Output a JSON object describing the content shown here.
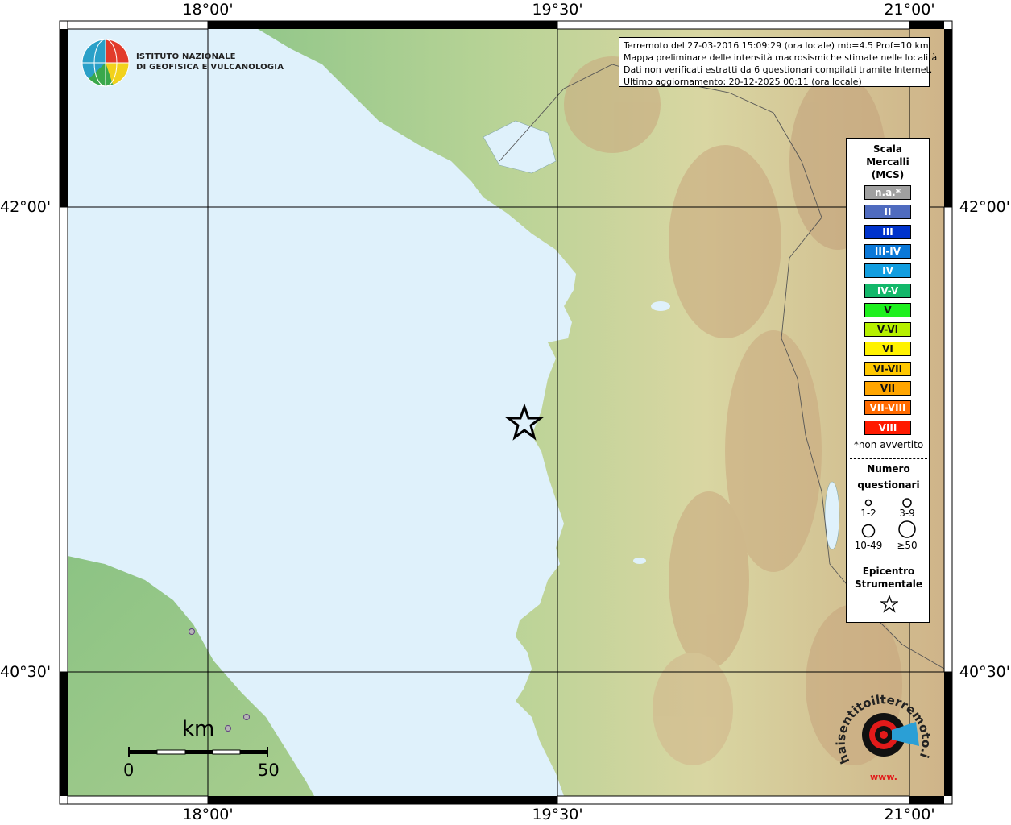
{
  "axes": {
    "lon_ticks": [
      "18°00'",
      "19°30'",
      "21°00'"
    ],
    "lat_ticks": [
      "42°00'",
      "40°30'"
    ]
  },
  "logo": {
    "line1": "ISTITUTO NAZIONALE",
    "line2": "DI GEOFISICA E VULCANOLOGIA"
  },
  "info": {
    "line1": "Terremoto del 27-03-2016 15:09:29 (ora locale) mb=4.5 Prof=10 km",
    "line2": "Mappa preliminare delle intensità macrosismiche stimate nelle località",
    "line3": "Dati non verificati estratti da 6 questionari compilati tramite Internet.",
    "line4": "Ultimo aggiornamento: 20-12-2025 00:11 (ora locale)"
  },
  "legend": {
    "title_line1": "Scala",
    "title_line2": "Mercalli",
    "title_line3": "(MCS)",
    "scale": [
      {
        "label": "n.a.*",
        "color": "#a0a0a0"
      },
      {
        "label": "II",
        "color": "#4f6bbf"
      },
      {
        "label": "III",
        "color": "#0033cc"
      },
      {
        "label": "III-IV",
        "color": "#0a78d8"
      },
      {
        "label": "IV",
        "color": "#129ee0"
      },
      {
        "label": "IV-V",
        "color": "#13b86a"
      },
      {
        "label": "V",
        "color": "#1ef01e"
      },
      {
        "label": "V-VI",
        "color": "#b6f000"
      },
      {
        "label": "VI",
        "color": "#fff200"
      },
      {
        "label": "VI-VII",
        "color": "#ffc800"
      },
      {
        "label": "VII",
        "color": "#ffa500"
      },
      {
        "label": "VII-VIII",
        "color": "#ff6a00"
      },
      {
        "label": "VIII",
        "color": "#ff1a00"
      }
    ],
    "not_felt_note": "*non avvertito",
    "questionnaire_title_line1": "Numero",
    "questionnaire_title_line2": "questionari",
    "q_sizes": [
      "1-2",
      "3-9",
      "10-49",
      "≥50"
    ],
    "epicenter_title_line1": "Epicentro",
    "epicenter_title_line2": "Strumentale"
  },
  "scale_bar": {
    "unit": "km",
    "start": "0",
    "end": "50"
  },
  "epicenter": {
    "lon": 19.4,
    "lat": 41.53
  },
  "colors": {
    "sea": "#dff1fb",
    "land_low": "#97c98a",
    "land_mid": "#d6dca4",
    "land_high": "#c9a57c",
    "snow": "#f5f0ea"
  },
  "brand": {
    "text": "haisentitoilterremoto.it",
    "url_mark": "www."
  }
}
